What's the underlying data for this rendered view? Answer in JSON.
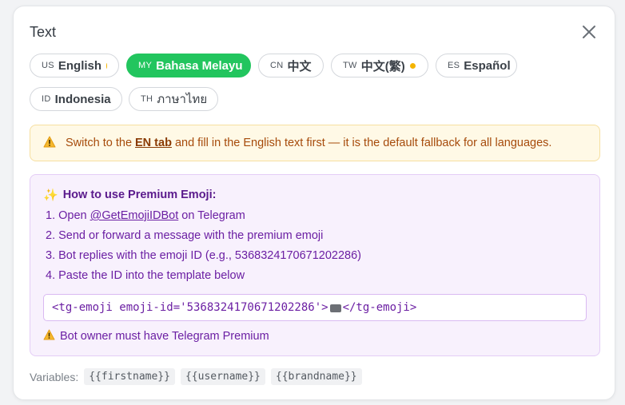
{
  "panel": {
    "title": "Text"
  },
  "tabs": [
    {
      "code": "US",
      "name": "English",
      "dot": true,
      "active": false
    },
    {
      "code": "MY",
      "name": "Bahasa Melayu",
      "dot": false,
      "active": true
    },
    {
      "code": "CN",
      "name": "中文",
      "dot": false,
      "active": false
    },
    {
      "code": "TW",
      "name": "中文(繁)",
      "dot": true,
      "active": false
    },
    {
      "code": "ES",
      "name": "Español",
      "dot": false,
      "active": false
    },
    {
      "code": "ID",
      "name": "Indonesia",
      "dot": false,
      "active": false
    },
    {
      "code": "TH",
      "name": "ภาษาไทย",
      "dot": false,
      "active": false
    }
  ],
  "warning": {
    "prefix": "Switch to the",
    "link": "EN tab",
    "suffix": "and fill in the English text first — it is the default fallback for all languages."
  },
  "emoji_help": {
    "heading": "How to use Premium Emoji:",
    "step1_prefix": "1. Open",
    "step1_link": "@GetEmojiIDBot",
    "step1_suffix": "on Telegram",
    "step2": "2. Send or forward a message with the premium emoji",
    "step3": "3. Bot replies with the emoji ID (e.g., 5368324170671202286)",
    "step4": "4. Paste the ID into the template below",
    "code_start": "<tg-emoji emoji-id='5368324170671202286'>",
    "code_end": "</tg-emoji>",
    "owner_note": "Bot owner must have Telegram Premium"
  },
  "variables": {
    "label": "Variables:",
    "items": [
      "{{firstname}}",
      "{{username}}",
      "{{brandname}}"
    ]
  },
  "colors": {
    "accent": "#22c55e",
    "warning_text": "#a64b0b",
    "info_text": "#6b1fa3",
    "dot": "#f4b400"
  }
}
